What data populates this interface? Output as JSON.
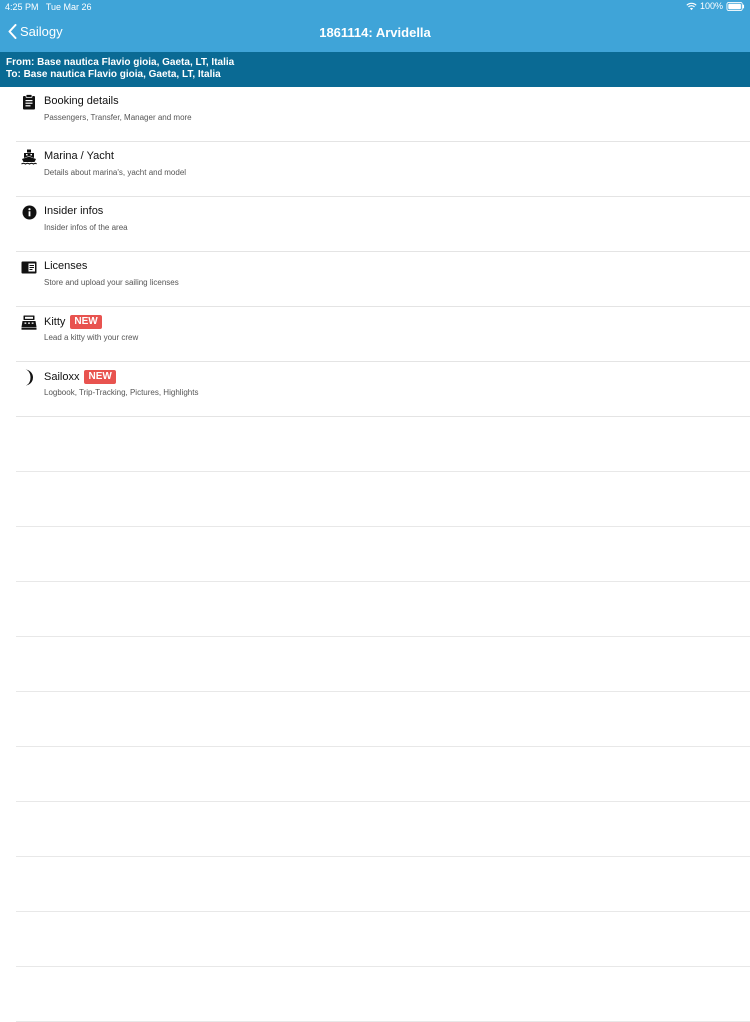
{
  "status": {
    "time": "4:25 PM",
    "date": "Tue Mar 26",
    "battery": "100%"
  },
  "nav": {
    "back_label": "Sailogy",
    "title": "1861114: Arvidella"
  },
  "route": {
    "from": "From: Base nautica Flavio gioia, Gaeta, LT, Italia",
    "to": "To: Base nautica Flavio gioia, Gaeta, LT, Italia"
  },
  "menu": [
    {
      "title": "Booking details",
      "subtitle": "Passengers, Transfer, Manager and more",
      "icon": "clipboard-icon",
      "badge": ""
    },
    {
      "title": "Marina / Yacht",
      "subtitle": "Details about marina's, yacht and model",
      "icon": "ferry-icon",
      "badge": ""
    },
    {
      "title": "Insider infos",
      "subtitle": "Insider infos of the area",
      "icon": "info-icon",
      "badge": ""
    },
    {
      "title": "Licenses",
      "subtitle": "Store and upload your sailing licenses",
      "icon": "license-card-icon",
      "badge": ""
    },
    {
      "title": "Kitty",
      "subtitle": "Lead a kitty with your crew",
      "icon": "cash-register-icon",
      "badge": "NEW"
    },
    {
      "title": "Sailoxx",
      "subtitle": "Logbook, Trip-Tracking, Pictures, Highlights",
      "icon": "moon-icon",
      "badge": "NEW"
    }
  ]
}
